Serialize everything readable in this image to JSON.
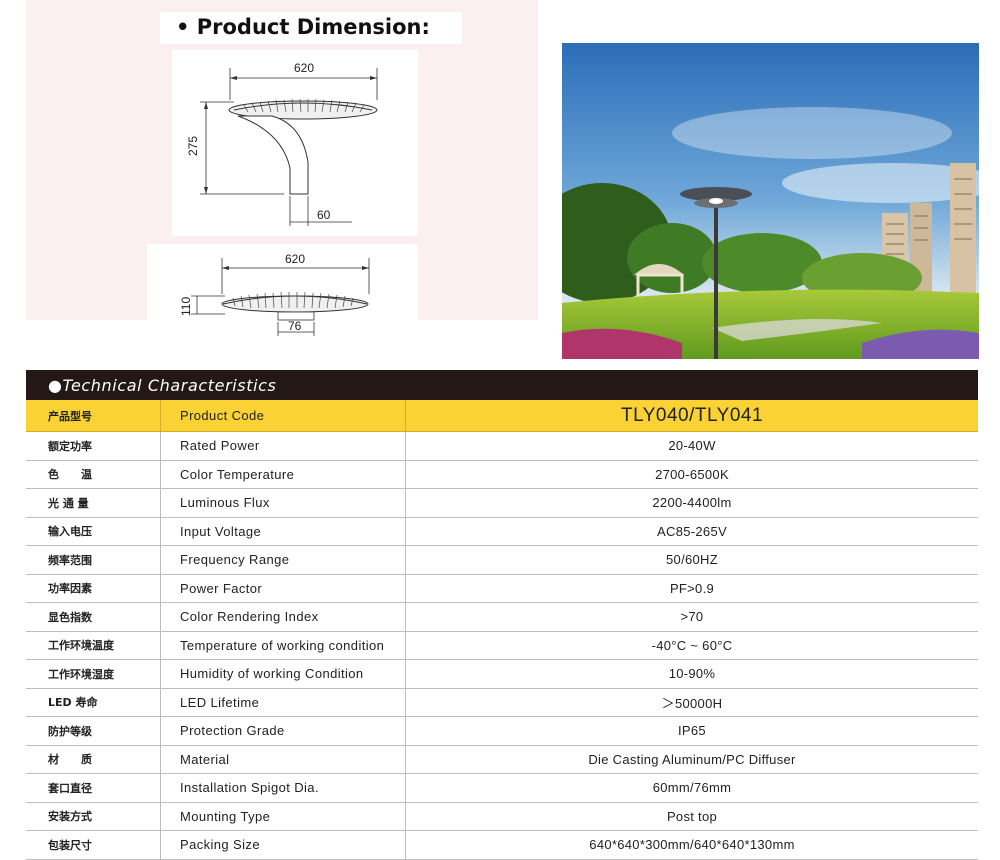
{
  "dimension": {
    "title": "• Product Dimension:",
    "side_view": {
      "width": "620",
      "height": "275",
      "pole": "60"
    },
    "front_view": {
      "width": "620",
      "height": "110",
      "spigot": "76"
    }
  },
  "photo": {
    "icon": "street-lamp-photo"
  },
  "technical": {
    "title": "●Technical Characteristics",
    "header": {
      "cn": "产品型号",
      "en": "Product Code",
      "value": "TLY040/TLY041"
    },
    "rows": [
      {
        "cn": "额定功率",
        "en": "Rated Power",
        "value": "20-40W"
      },
      {
        "cn": "色　　温",
        "en": "Color Temperature",
        "value": "2700-6500K"
      },
      {
        "cn": "光 通 量",
        "en": "Luminous Flux",
        "value": "2200-4400lm"
      },
      {
        "cn": "输入电压",
        "en": "Input Voltage",
        "value": "AC85-265V"
      },
      {
        "cn": "频率范围",
        "en": "Frequency Range",
        "value": "50/60HZ"
      },
      {
        "cn": "功率因素",
        "en": "Power Factor",
        "value": "PF>0.9"
      },
      {
        "cn": "显色指数",
        "en": "Color Rendering Index",
        "value": ">70"
      },
      {
        "cn": "工作环境温度",
        "en": "Temperature of working condition",
        "value": "-40°C ~ 60°C"
      },
      {
        "cn": "工作环境湿度",
        "en": "Humidity of working Condition",
        "value": "10-90%"
      },
      {
        "cn": "LED 寿命",
        "en": "LED Lifetime",
        "value": "＞50000H"
      },
      {
        "cn": "防护等级",
        "en": "Protection Grade",
        "value": "IP65"
      },
      {
        "cn": "材　　质",
        "en": "Material",
        "value": "Die Casting Aluminum/PC Diffuser"
      },
      {
        "cn": "套口直径",
        "en": "Installation Spigot Dia.",
        "value": "60mm/76mm"
      },
      {
        "cn": "安装方式",
        "en": "Mounting Type",
        "value": "Post top"
      },
      {
        "cn": "包装尺寸",
        "en": "Packing Size",
        "value": "640*640*300mm/640*640*130mm"
      }
    ]
  }
}
